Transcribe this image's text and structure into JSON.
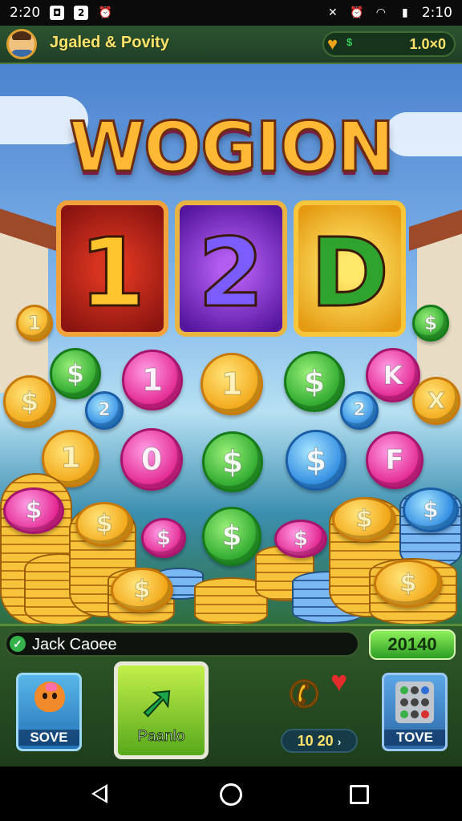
{
  "status_bar": {
    "time_left": "2:20",
    "time_right": "2:10",
    "left_icons": [
      "bag-icon",
      "notification-icon",
      "alarm-icon"
    ],
    "right_icons": [
      "no-signal-icon",
      "alarm-icon",
      "wifi-icon",
      "battery-icon"
    ]
  },
  "top_bar": {
    "player_name": "Jgaled & Povity",
    "balance": "1.0×0",
    "balance_icon": "heart-dollar-icon"
  },
  "title": {
    "text": "WOGION",
    "tiles": [
      "1",
      "2",
      "D"
    ]
  },
  "coins": {
    "floating": [
      "1",
      "$",
      "2",
      "1",
      "1",
      "$",
      "2",
      "$",
      "$",
      "K",
      "0",
      "$",
      "$",
      "F",
      "1",
      "$",
      "X"
    ]
  },
  "bottom": {
    "message": "Jack Caoee",
    "score": "20140",
    "save_label": "SOVE",
    "main_label": "Paanlo",
    "phone_counter": "10 20",
    "right_label": "TOVE"
  },
  "nav": {
    "back": "back-icon",
    "home": "home-icon",
    "recent": "recent-apps-icon"
  }
}
